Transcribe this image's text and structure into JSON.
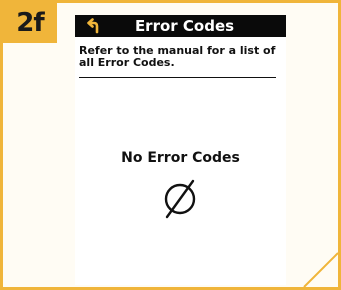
{
  "step_badge": "2f",
  "screen": {
    "title": "Error Codes",
    "info_text": "Refer to the manual for a list of all Error Codes.",
    "status_text": "No Error Codes"
  },
  "icons": {
    "back": "back-arrow-icon",
    "empty": "empty-set-icon"
  },
  "colors": {
    "accent": "#f0b53a",
    "title_bar": "#0a0a0a",
    "back_arrow": "#f0b53a"
  }
}
